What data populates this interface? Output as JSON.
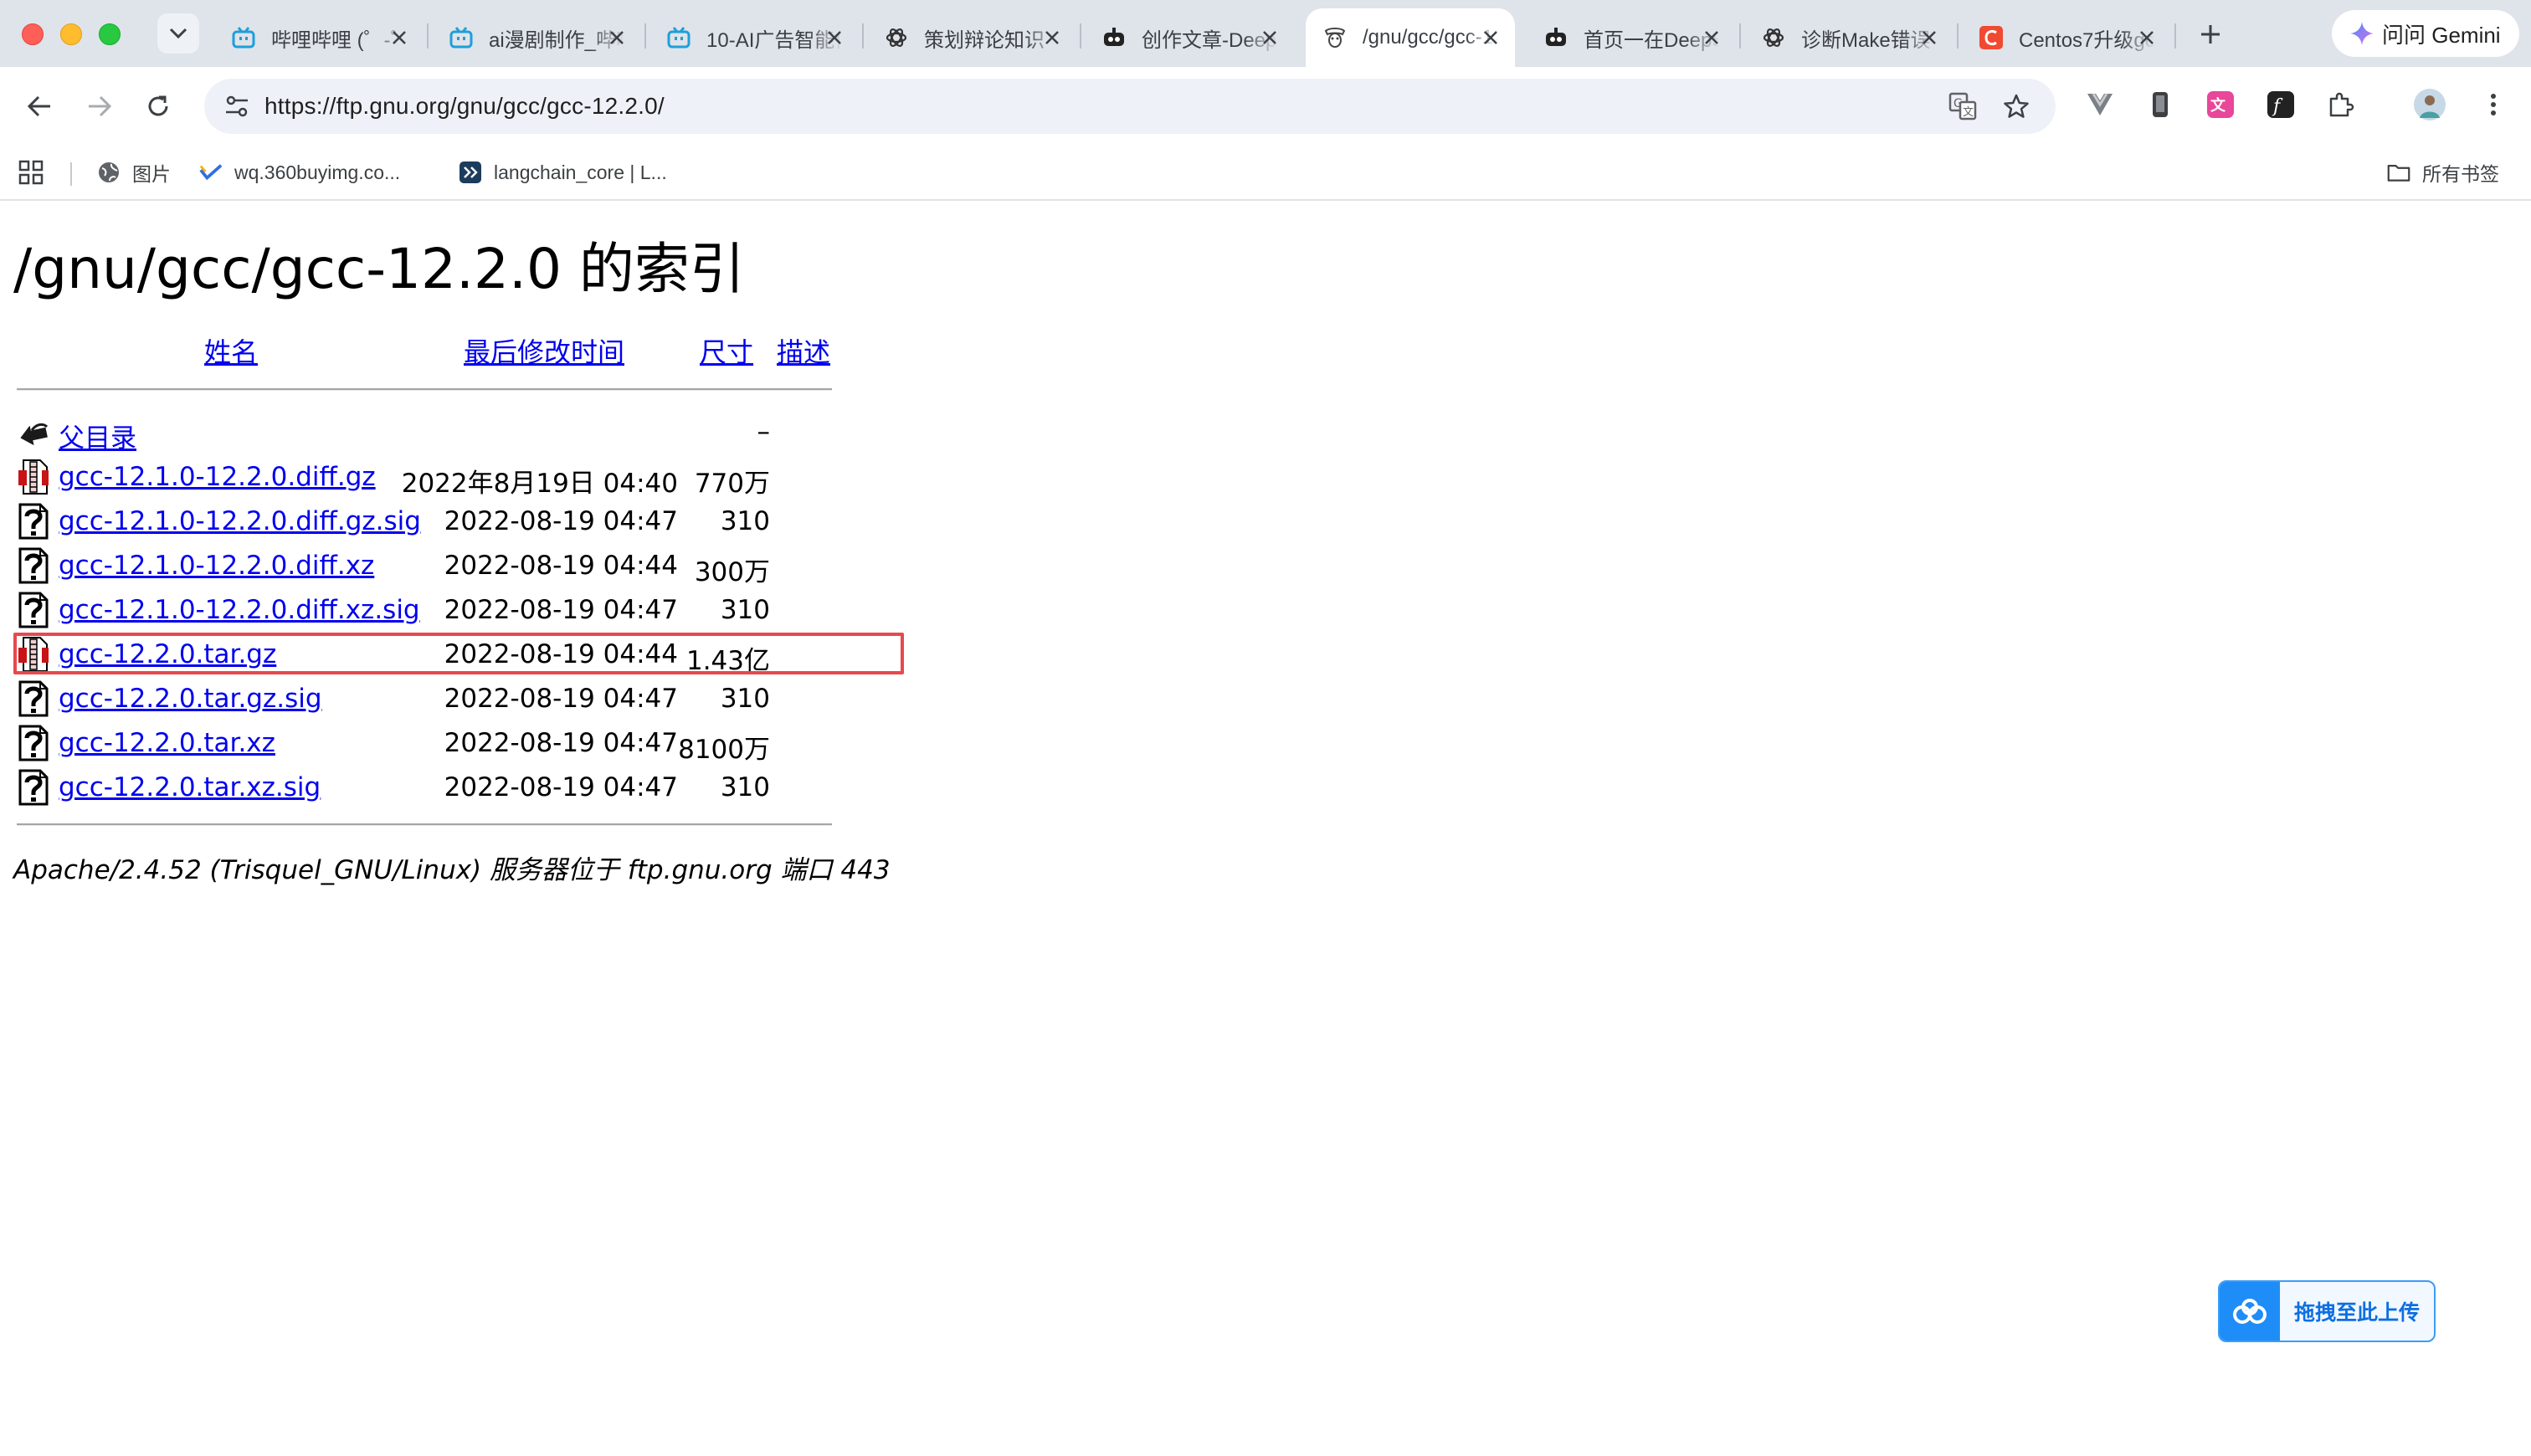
{
  "browser": {
    "tabs": [
      {
        "title": "哔哩哔哩 (゜-゜)つロ",
        "favicon": "bilibili-icon"
      },
      {
        "title": "ai漫剧制作_哔哩哔哩",
        "favicon": "bilibili-icon"
      },
      {
        "title": "10-AI广告智能体",
        "favicon": "bilibili-icon"
      },
      {
        "title": "策划辩论知识",
        "favicon": "openai-icon"
      },
      {
        "title": "创作文章-DeepSeek",
        "favicon": "robot-icon"
      },
      {
        "title": "/gnu/gcc/gcc-12.2.0",
        "favicon": "gnu-icon",
        "active": true
      },
      {
        "title": "首页一在DeepSeek",
        "favicon": "robot-icon"
      },
      {
        "title": "诊断Make错误",
        "favicon": "openai-icon"
      },
      {
        "title": "Centos7升级gcc",
        "favicon": "csdn-icon"
      }
    ],
    "gemini_label": "问问 Gemini",
    "url": "https://ftp.gnu.org/gnu/gcc/gcc-12.2.0/",
    "bookmarks": [
      {
        "label": "图片",
        "icon": "globe-icon"
      },
      {
        "label": "wq.360buyimg.co...",
        "icon": "check-icon"
      },
      {
        "label": "langchain_core | L...",
        "icon": "langchain-icon"
      }
    ],
    "all_bookmarks_label": "所有书签"
  },
  "listing": {
    "title": "/gnu/gcc/gcc-12.2.0 的索引",
    "headers": {
      "name": "姓名",
      "modified": "最后修改时间",
      "size": "尺寸",
      "description": "描述"
    },
    "parent": {
      "name": "父目录",
      "size": "–"
    },
    "files": [
      {
        "name": "gcc-12.1.0-12.2.0.diff.gz",
        "modified": "2022年8月19日 04:40",
        "size": "770万",
        "icon": "compressed-file-icon"
      },
      {
        "name": "gcc-12.1.0-12.2.0.diff.gz.sig",
        "modified": "2022-08-19 04:47",
        "size": "310",
        "icon": "unknown-file-icon"
      },
      {
        "name": "gcc-12.1.0-12.2.0.diff.xz",
        "modified": "2022-08-19 04:44",
        "size": "300万",
        "icon": "unknown-file-icon"
      },
      {
        "name": "gcc-12.1.0-12.2.0.diff.xz.sig",
        "modified": "2022-08-19 04:47",
        "size": "310",
        "icon": "unknown-file-icon"
      },
      {
        "name": "gcc-12.2.0.tar.gz",
        "modified": "2022-08-19 04:44",
        "size": "1.43亿",
        "icon": "compressed-file-icon",
        "highlighted": true
      },
      {
        "name": "gcc-12.2.0.tar.gz.sig",
        "modified": "2022-08-19 04:47",
        "size": "310",
        "icon": "unknown-file-icon"
      },
      {
        "name": "gcc-12.2.0.tar.xz",
        "modified": "2022-08-19 04:47",
        "size": "8100万",
        "icon": "unknown-file-icon"
      },
      {
        "name": "gcc-12.2.0.tar.xz.sig",
        "modified": "2022-08-19 04:47",
        "size": "310",
        "icon": "unknown-file-icon"
      }
    ],
    "server_signature": "Apache/2.4.52 (Trisquel_GNU/Linux) 服务器位于 ftp.gnu.org 端口 443",
    "highlight_color": "#e8484e",
    "link_color": "#0000ee"
  },
  "upload_widget": {
    "label": "拖拽至此上传",
    "icon": "baidu-cloud-icon",
    "color": "#1e8df7"
  }
}
